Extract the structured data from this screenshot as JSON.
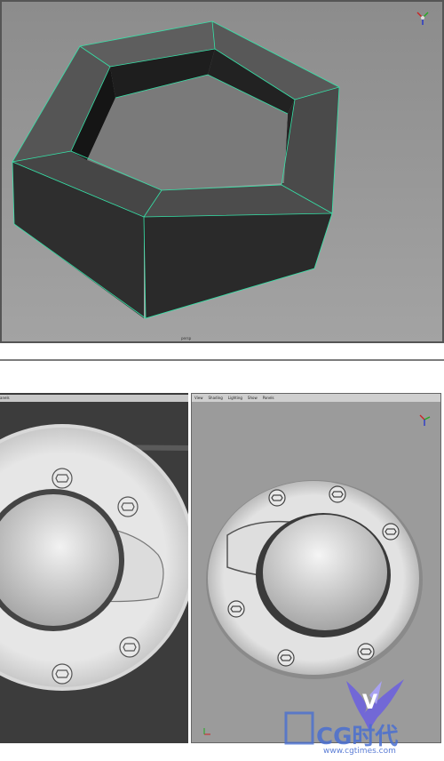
{
  "top_viewport": {
    "label": "persp"
  },
  "left_panel": {
    "menu_fragment": "anels"
  },
  "right_panel": {
    "menu": [
      "View",
      "Shading",
      "Lighting",
      "Show",
      "Panels"
    ]
  },
  "watermark": {
    "brand": "CG时代",
    "letter": "V",
    "url": "www.cgtimes.com"
  },
  "colors": {
    "viewport_bg": "#9a9a9a",
    "wire": "#35e3a8",
    "dark_bg": "#3a3a3a",
    "watermark": "#4a6fd1"
  }
}
